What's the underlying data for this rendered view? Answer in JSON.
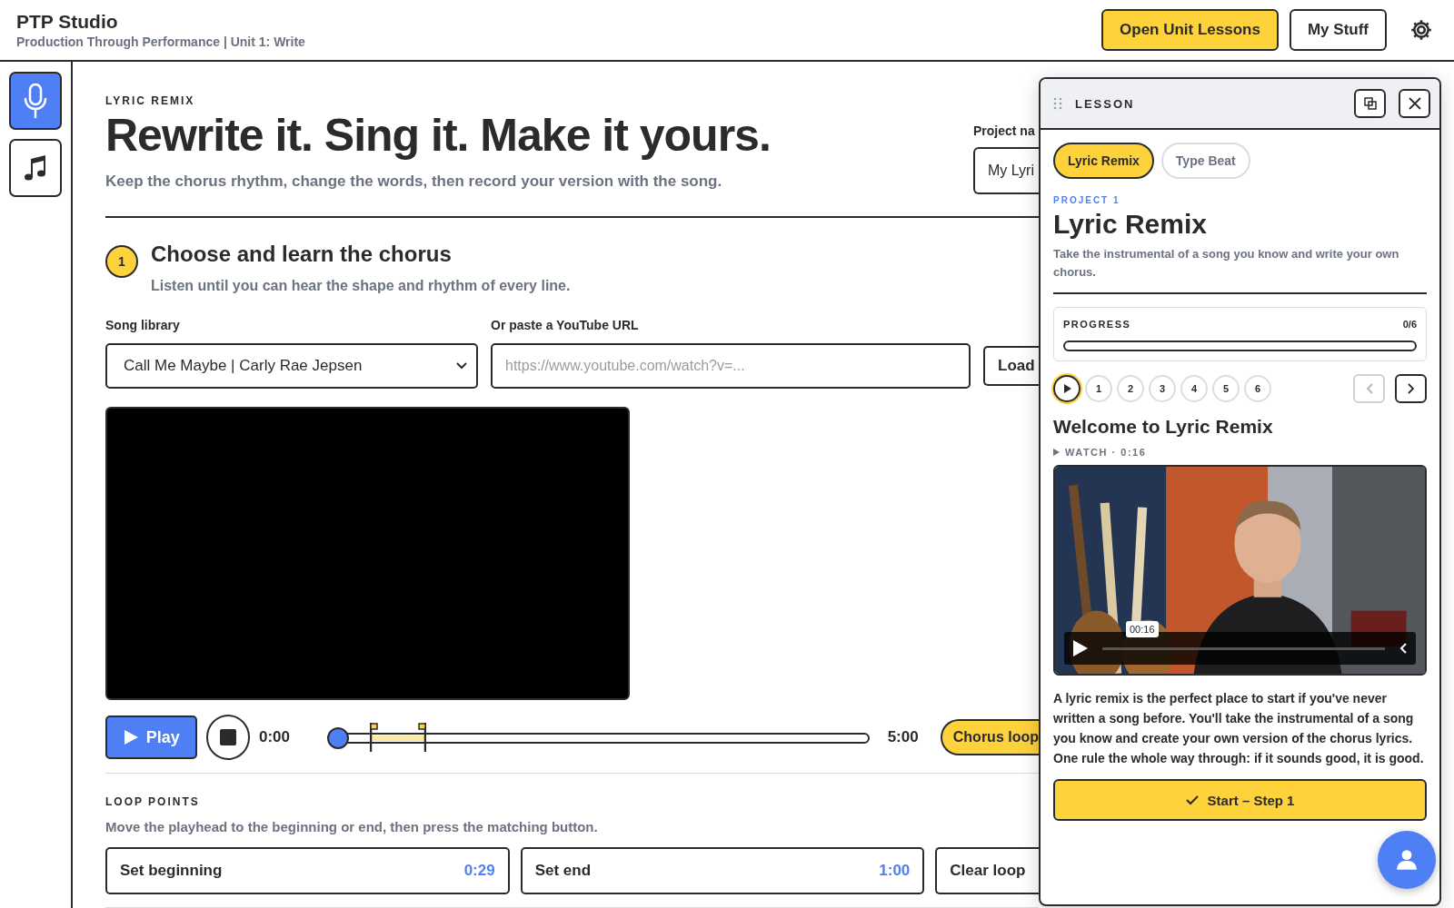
{
  "header": {
    "title": "PTP Studio",
    "subtitle": "Production Through Performance | Unit 1: Write",
    "buttons": [
      {
        "label": "Open Unit Lessons",
        "kind": "primary"
      },
      {
        "label": "My Stuff",
        "kind": "secondary"
      }
    ]
  },
  "sidebar": {
    "items": [
      {
        "kind": "mic",
        "selected": true
      },
      {
        "kind": "note",
        "selected": false
      }
    ]
  },
  "page": {
    "eyebrow": "LYRIC REMIX",
    "title": "Rewrite it. Sing it. Make it yours.",
    "subtitle": "Keep the chorus rhythm, change the words, then record your version with the song.",
    "project_name": {
      "label": "Project na",
      "value": "My Lyri"
    }
  },
  "step": {
    "number": "1",
    "title": "Choose and learn the chorus",
    "subtitle": "Listen until you can hear the shape and rhythm of every line."
  },
  "song_library": {
    "label": "Song library",
    "value": "Call Me Maybe | Carly Rae Jepsen"
  },
  "youtube": {
    "label": "Or paste a YouTube URL",
    "placeholder": "https://www.youtube.com/watch?v=...",
    "button": "Load"
  },
  "player": {
    "play": "Play",
    "time": "0:00",
    "duration": "5:00",
    "playhead": {
      "level": 0
    },
    "loop_start": {
      "level": 0.082
    },
    "loop_end": {
      "level": 0.18
    },
    "chorus_loop": {
      "label": "Chorus loop",
      "on": true
    }
  },
  "loop_points": {
    "heading": "LOOP POINTS",
    "hint": "Move the playhead to the beginning or end, then press the matching button.",
    "buttons": [
      {
        "label": "Set beginning",
        "time": "0:29"
      },
      {
        "label": "Set end",
        "time": "1:00"
      },
      {
        "label": "Clear loop"
      }
    ]
  },
  "lesson_panel": {
    "title": "LESSON",
    "tabs": [
      {
        "label": "Lyric Remix",
        "selected": true
      },
      {
        "label": "Type Beat",
        "selected": false
      }
    ],
    "eyebrow": "PROJECT 1",
    "heading": "Lyric Remix",
    "description": "Take the instrumental of a song you know and write your own chorus.",
    "progress": {
      "label": "PROGRESS",
      "count": "0/6",
      "level": 0
    },
    "steps": [
      {
        "kind": "intro",
        "selected": true
      },
      {
        "kind": "number",
        "label": "1",
        "selected": false
      },
      {
        "kind": "number",
        "label": "2",
        "selected": false
      },
      {
        "kind": "number",
        "label": "3",
        "selected": false
      },
      {
        "kind": "number",
        "label": "4",
        "selected": false
      },
      {
        "kind": "number",
        "label": "5",
        "selected": false
      },
      {
        "kind": "number",
        "label": "6",
        "selected": false
      }
    ],
    "nav": {
      "prev_disabled": true,
      "next_disabled": false
    },
    "lesson_title": "Welcome to Lyric Remix",
    "watch": "WATCH · 0:16",
    "video": {
      "kind": "picture",
      "tooltip": "00:16",
      "progress": {
        "level": 0
      }
    },
    "body": "A lyric remix is the perfect place to start if you've never written a song before. You'll take the instrumental of a song you know and create your own version of the chorus lyrics. One rule the whole way through: if it sounds good, it is good.",
    "start_button": "Start – Step 1"
  }
}
